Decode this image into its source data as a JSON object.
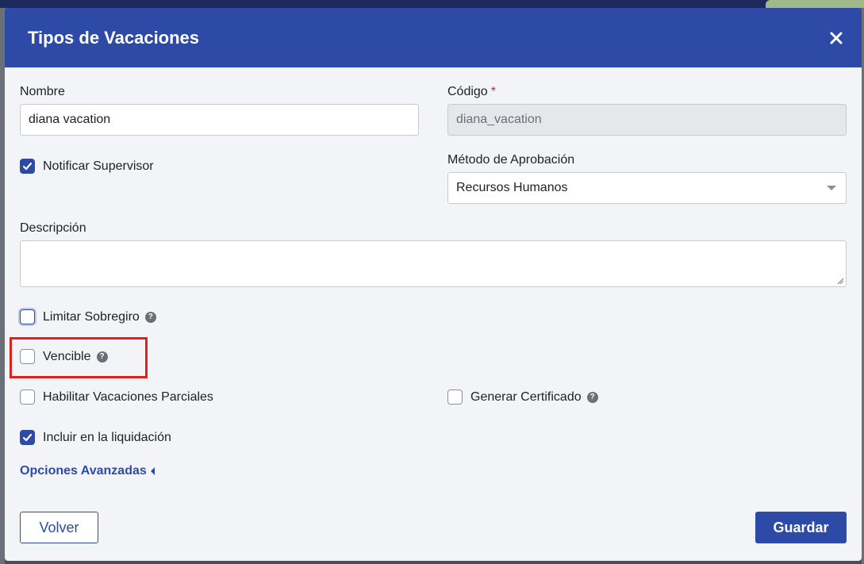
{
  "modal": {
    "title": "Tipos de Vacaciones",
    "close_icon": "close-icon"
  },
  "form": {
    "nombre": {
      "label": "Nombre",
      "value": "diana vacation"
    },
    "codigo": {
      "label": "Código",
      "required_mark": "*",
      "value": "diana_vacation"
    },
    "notificar_supervisor": {
      "label": "Notificar Supervisor",
      "checked": true
    },
    "metodo_aprobacion": {
      "label": "Método de Aprobación",
      "selected": "Recursos Humanos"
    },
    "descripcion": {
      "label": "Descripción",
      "value": ""
    },
    "limitar_sobregiro": {
      "label": "Limitar Sobregiro",
      "checked": false,
      "help": "?"
    },
    "vencible": {
      "label": "Vencible",
      "checked": false,
      "help": "?"
    },
    "habilitar_parciales": {
      "label": "Habilitar Vacaciones Parciales",
      "checked": false
    },
    "generar_certificado": {
      "label": "Generar Certificado",
      "checked": false,
      "help": "?"
    },
    "incluir_liquidacion": {
      "label": "Incluir en la liquidación",
      "checked": true
    },
    "opciones_avanzadas": "Opciones Avanzadas"
  },
  "footer": {
    "back_label": "Volver",
    "save_label": "Guardar"
  },
  "colors": {
    "primary": "#2d4ba6",
    "highlight": "#e0211c",
    "required": "#d3262d"
  }
}
